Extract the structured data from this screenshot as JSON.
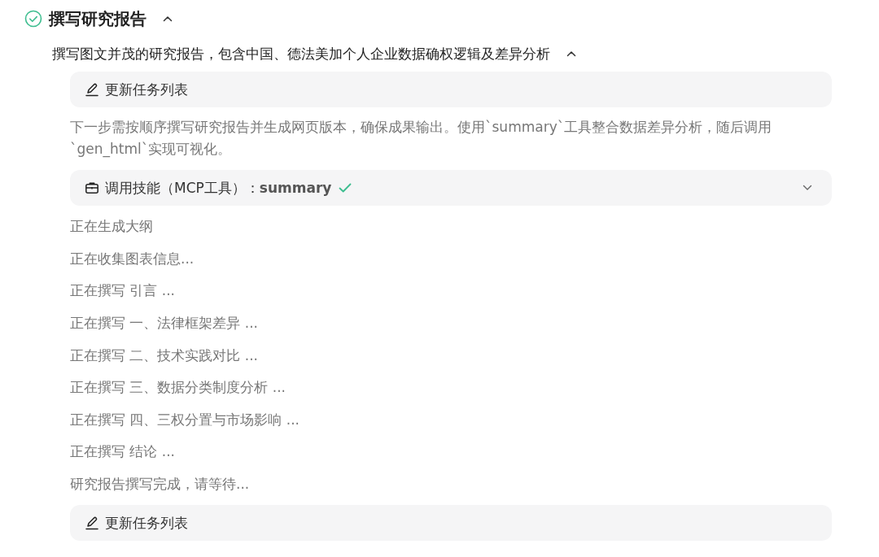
{
  "task": {
    "title": "撰写研究报告",
    "done": true,
    "expanded": true,
    "description": "撰写图文并茂的研究报告，包含中国、德法美加个人企业数据确权逻辑及差异分析",
    "description_expanded": true,
    "steps": [
      {
        "kind": "task_update",
        "label": "更新任务列表"
      },
      {
        "kind": "paragraph",
        "text": "下一步需按顺序撰写研究报告并生成网页版本，确保成果输出。使用`summary`工具整合数据差异分析，随后调用`gen_html`实现可视化。"
      },
      {
        "kind": "tool",
        "label": "调用技能（MCP工具）：",
        "name": "summary",
        "done": true,
        "expanded": false
      },
      {
        "kind": "status",
        "text": "正在生成大纲"
      },
      {
        "kind": "status",
        "text": "正在收集图表信息..."
      },
      {
        "kind": "status",
        "text": "正在撰写 引言 ..."
      },
      {
        "kind": "status",
        "text": "正在撰写 一、法律框架差异 ..."
      },
      {
        "kind": "status",
        "text": "正在撰写 二、技术实践对比 ..."
      },
      {
        "kind": "status",
        "text": "正在撰写 三、数据分类制度分析 ..."
      },
      {
        "kind": "status",
        "text": "正在撰写 四、三权分置与市场影响 ..."
      },
      {
        "kind": "status",
        "text": "正在撰写 结论 ..."
      },
      {
        "kind": "status",
        "text": "研究报告撰写完成，请等待..."
      },
      {
        "kind": "task_update",
        "label": "更新任务列表"
      }
    ]
  }
}
